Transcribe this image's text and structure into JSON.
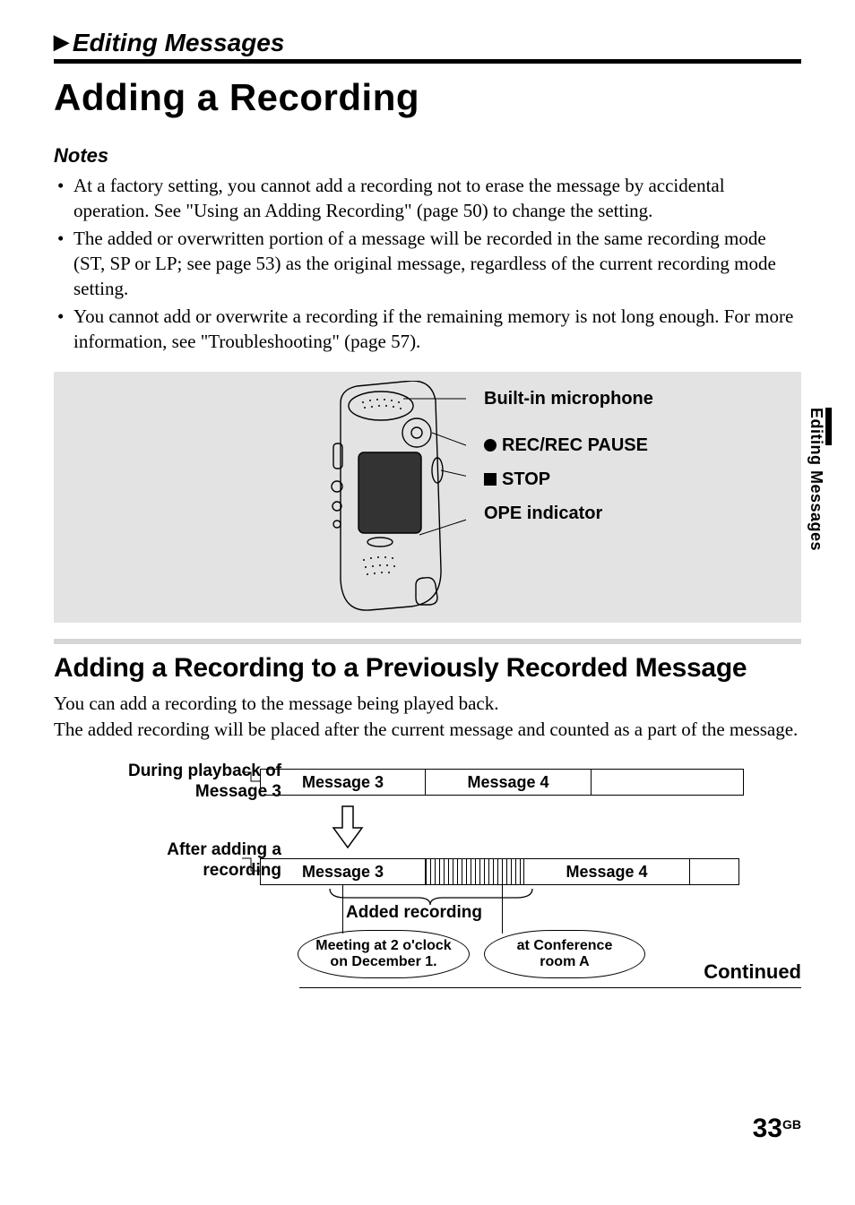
{
  "section_header": "Editing Messages",
  "page_title": "Adding a Recording",
  "notes_heading": "Notes",
  "notes": [
    "At a factory setting, you cannot add a recording not to erase the message by accidental operation. See \"Using an Adding Recording\" (page 50) to change the setting.",
    "The added or overwritten portion of a message will be recorded in the same recording mode (ST, SP or LP; see page 53) as the original message, regardless of the current recording mode setting.",
    "You cannot add or overwrite a recording if the remaining memory is not long enough. For more information, see \"Troubleshooting\" (page 57)."
  ],
  "callouts": {
    "mic": "Built-in microphone",
    "rec": "REC/REC PAUSE",
    "stop": "STOP",
    "ope": "OPE indicator"
  },
  "h2": "Adding a Recording to a Previously Recorded Message",
  "body": "You can add a recording to the message being played back.\nThe added recording will be placed after the current message and counted as a part of the message.",
  "diagram": {
    "label_top": "During playback of Message 3",
    "label_bottom": "After adding a recording",
    "msg3": "Message 3",
    "msg4": "Message 4",
    "added": "Added recording",
    "bubble1": "Meeting at 2 o'clock on December 1.",
    "bubble2": "at Conference room A"
  },
  "continued": "Continued",
  "side_tab": "Editing Messages",
  "page_number": "33",
  "page_suffix": "GB"
}
